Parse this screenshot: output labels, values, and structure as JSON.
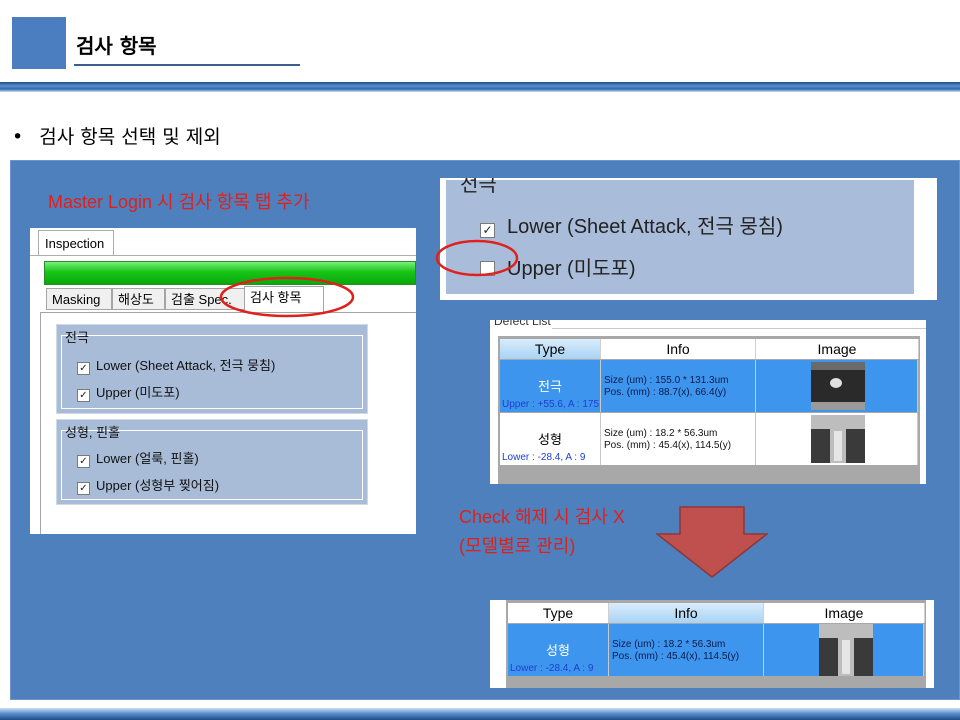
{
  "slide": {
    "title": "검사 항목",
    "bullet": "검사 항목 선택 및 제외",
    "bullet_mark": "•"
  },
  "notes": {
    "master_login": "Master Login 시 검사 항목 탭 추가",
    "check_release_line1": "Check 해제 시 검사 X",
    "check_release_line2": "(모델별로 관리)"
  },
  "inspection_window": {
    "tab_label": "Inspection",
    "subtabs": [
      "Masking",
      "해상도",
      "검출 Spec.",
      "검사 항목"
    ],
    "active_subtab_index": 3,
    "groups": [
      {
        "title": "전극",
        "items": [
          {
            "label": "Lower (Sheet Attack, 전극 뭉침)",
            "checked": true
          },
          {
            "label": "Upper (미도포)",
            "checked": true
          }
        ]
      },
      {
        "title": "성형, 핀홀",
        "items": [
          {
            "label": "Lower (얼룩, 핀홀)",
            "checked": true
          },
          {
            "label": "Upper (성형부 찢어짐)",
            "checked": true
          }
        ]
      }
    ]
  },
  "zoom_panel": {
    "group_title": "전극",
    "items": [
      {
        "label": "Lower (Sheet Attack, 전극 뭉침)",
        "checked": true
      },
      {
        "label": "Upper (미도포)",
        "checked": false
      }
    ]
  },
  "defect_list": {
    "tab_label": "Defect List",
    "columns": [
      "Type",
      "Info",
      "Image"
    ],
    "rows": [
      {
        "type": "전극",
        "sub": "Upper : +55.6, A : 175",
        "info_size": "Size (um) : 155.0 * 131.3um",
        "info_pos": "Pos. (mm) : 88.7(x), 66.4(y)",
        "selected": true
      },
      {
        "type": "성형",
        "sub": "Lower : -28.4, A : 9",
        "info_size": "Size (um) : 18.2 * 56.3um",
        "info_pos": "Pos. (mm) : 45.4(x), 114.5(y)",
        "selected": false
      }
    ]
  },
  "after_list": {
    "columns": [
      "Type",
      "Info",
      "Image"
    ],
    "rows": [
      {
        "type": "성형",
        "sub": "Lower : -28.4, A : 9",
        "info_size": "Size (um) : 18.2 * 56.3um",
        "info_pos": "Pos. (mm) : 45.4(x), 114.5(y)",
        "selected": true
      }
    ]
  },
  "colors": {
    "panel_blue": "#4f80be",
    "note_red": "#e0201a",
    "progress_green": "#17c517",
    "selected_row": "#3d95ee",
    "arrow_fill": "#c0504d"
  }
}
